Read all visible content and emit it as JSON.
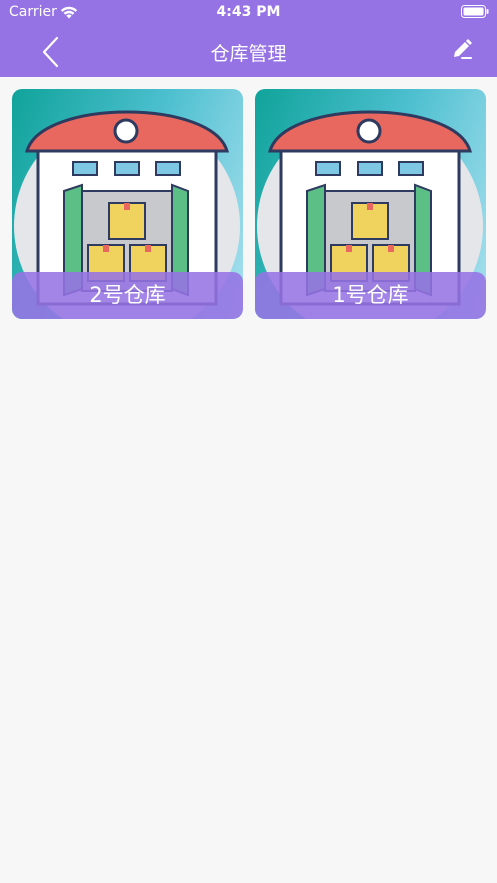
{
  "status_bar": {
    "carrier": "Carrier",
    "time": "4:43 PM"
  },
  "nav": {
    "title": "仓库管理",
    "back_icon": "chevron-left-icon",
    "edit_icon": "edit-pencil-icon"
  },
  "warehouses": [
    {
      "label": "2号仓库",
      "image": "warehouse-illustration"
    },
    {
      "label": "1号仓库",
      "image": "warehouse-illustration"
    }
  ],
  "colors": {
    "header": "#9673e4",
    "background": "#f7f7f7",
    "label_overlay": "#9673e4"
  }
}
